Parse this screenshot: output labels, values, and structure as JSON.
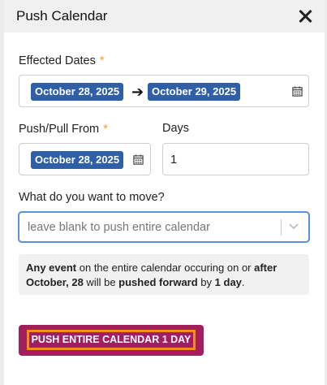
{
  "modal": {
    "title": "Push Calendar"
  },
  "effected_dates": {
    "label": "Effected Dates",
    "required_mark": "*",
    "start": "October 28, 2025",
    "end": "October 29, 2025"
  },
  "push_from": {
    "label": "Push/Pull From",
    "required_mark": "*",
    "value": "October 28, 2025"
  },
  "days": {
    "label": "Days",
    "value": "1"
  },
  "move": {
    "label": "What do you want to move?",
    "placeholder": "leave blank to push entire calendar"
  },
  "info": {
    "part1": "Any event",
    "part2": " on the entire calendar occuring on or ",
    "part3": "after October, 28",
    "part4": " will be ",
    "part5": "pushed forward",
    "part6": " by ",
    "part7": "1 day",
    "part8": "."
  },
  "action": {
    "button_label": "PUSH ENTIRE CALENDAR 1 DAY"
  },
  "colors": {
    "chip": "#2f5fa7",
    "required": "#f0a21b",
    "button": "#a31e5e",
    "button_outline": "#f28c1f",
    "focus": "#5b8fd6"
  },
  "icons": {
    "close": "close-icon",
    "calendar": "calendar-icon",
    "arrow": "arrow-right-icon",
    "chevron": "chevron-down-icon"
  }
}
